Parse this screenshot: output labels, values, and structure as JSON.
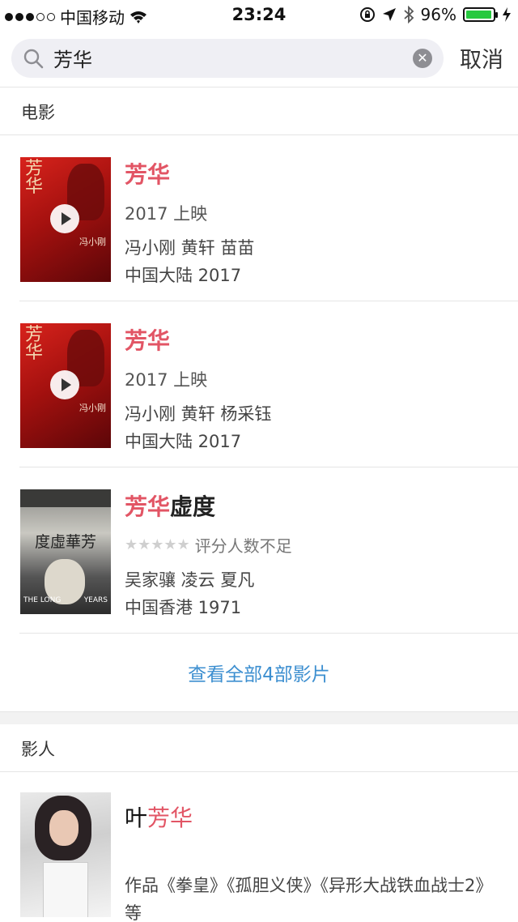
{
  "status_bar": {
    "carrier": "中国移动",
    "time": "23:24",
    "battery": "96%",
    "battery_level": 0.96,
    "signal_bars_on": 3,
    "signal_bars_total": 5
  },
  "search": {
    "query": "芳华",
    "cancel_label": "取消"
  },
  "sections": {
    "movies_label": "电影",
    "people_label": "影人"
  },
  "movies": [
    {
      "title_highlight": "芳华",
      "title_rest": "",
      "line1": "2017 上映",
      "cast": "冯小刚 黄轩 苗苗",
      "region_year": "中国大陆 2017",
      "poster_text": "芳华",
      "poster_name": "冯小刚",
      "has_trailer": true
    },
    {
      "title_highlight": "芳华",
      "title_rest": "",
      "line1": "2017 上映",
      "cast": "冯小刚 黄轩 杨采钰",
      "region_year": "中国大陆 2017",
      "poster_text": "芳华",
      "poster_name": "冯小刚",
      "has_trailer": true
    },
    {
      "title_highlight": "芳华",
      "title_rest": "虚度",
      "rating_text": "评分人数不足",
      "stars": 5,
      "cast": "吴家骧 凌云 夏凡",
      "region_year": "中国香港 1971",
      "poster_text": "度虛華芳",
      "poster_sub_left": "THE LONG",
      "poster_sub_right": "YEARS"
    }
  ],
  "see_all_label": "查看全部4部影片",
  "person": {
    "name_prefix": "叶",
    "name_highlight": "芳华",
    "works": "作品《拳皇》《孤胆义侠》《异形大战铁血战士2》等"
  },
  "colors": {
    "highlight": "#e25565",
    "link": "#3d8fd0",
    "battery": "#27c93f"
  }
}
